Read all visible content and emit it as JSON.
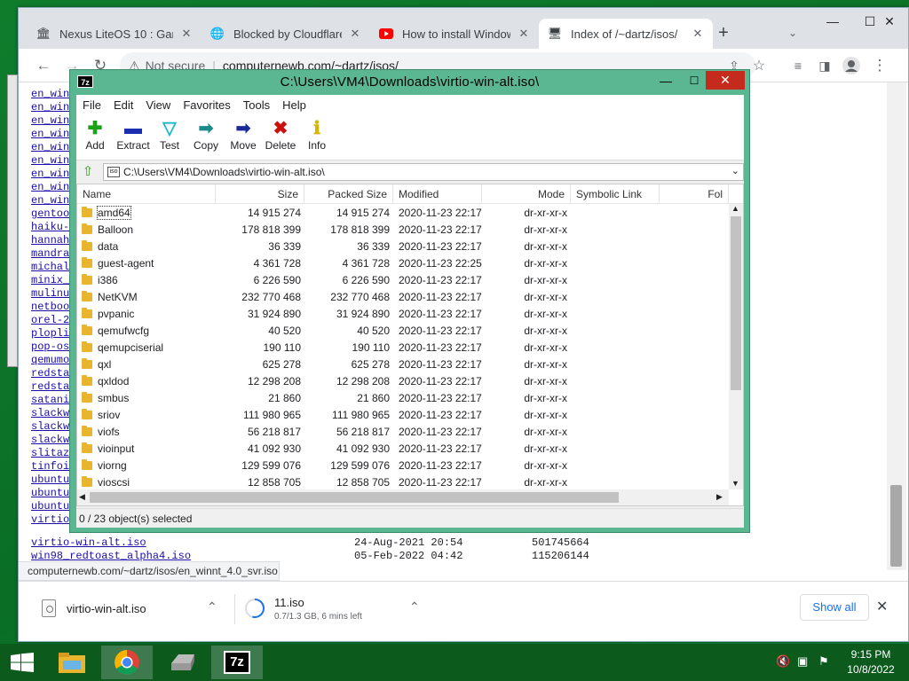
{
  "chrome": {
    "tabs": [
      {
        "title": "Nexus LiteOS 10 : Gam",
        "icon": "archive-icon"
      },
      {
        "title": "Blocked by Cloudflare C",
        "icon": "globe-icon"
      },
      {
        "title": "How to install Window",
        "icon": "youtube-icon"
      },
      {
        "title": "Index of /~dartz/isos/",
        "icon": "site-icon",
        "active": true
      }
    ],
    "new_tab": "+",
    "omnibox": {
      "security": "Not secure",
      "url": "computernewb.com/~dartz/isos/"
    },
    "status_url": "computernewb.com/~dartz/isos/en_winnt_4.0_svr.iso"
  },
  "listing": {
    "links": [
      "en_win",
      "en_win",
      "en_win",
      "en_win",
      "en_win",
      "en_win",
      "en_win",
      "en_win",
      "en_win",
      "gentoo",
      "haiku-",
      "hannah",
      "mandra",
      "michal",
      "minix_",
      "mulinu",
      "netboo",
      "orel-2",
      "plopli",
      "pop-os",
      "qemumo",
      "redsta",
      "redsta",
      "satani",
      "slackw",
      "slackw",
      "slackw",
      "slitaz",
      "tinfoi",
      "ubuntu",
      "ubuntu",
      "ubuntu",
      "virtio"
    ],
    "full_rows": [
      {
        "name": "virtio-win-alt.iso",
        "date": "24-Aug-2021 20:54",
        "size": "501745664"
      },
      {
        "name": "win98_redtoast_alpha4.iso",
        "date": "05-Feb-2022 04:42",
        "size": "115206144"
      }
    ]
  },
  "downloads": {
    "items": [
      {
        "name": "virtio-win-alt.iso",
        "detail": ""
      },
      {
        "name": "11.iso",
        "detail": "0.7/1.3 GB, 6 mins left",
        "progress": 0.54
      }
    ],
    "show_all": "Show all"
  },
  "sevenzip": {
    "title": "C:\\Users\\VM4\\Downloads\\virtio-win-alt.iso\\",
    "logo": "7z",
    "menu": [
      "File",
      "Edit",
      "View",
      "Favorites",
      "Tools",
      "Help"
    ],
    "tools": [
      {
        "label": "Add",
        "icon": "plus-icon",
        "color": "#1aa31a"
      },
      {
        "label": "Extract",
        "icon": "minus-icon",
        "color": "#1b2fb0"
      },
      {
        "label": "Test",
        "icon": "check-icon",
        "color": "#17b9c9"
      },
      {
        "label": "Copy",
        "icon": "copy-arrow-icon",
        "color": "#1a8a8a"
      },
      {
        "label": "Move",
        "icon": "move-arrow-icon",
        "color": "#1a2a9a"
      },
      {
        "label": "Delete",
        "icon": "x-icon",
        "color": "#cc1111"
      },
      {
        "label": "Info",
        "icon": "info-icon",
        "color": "#d9b400"
      }
    ],
    "address": "C:\\Users\\VM4\\Downloads\\virtio-win-alt.iso\\",
    "columns": [
      "Name",
      "Size",
      "Packed Size",
      "Modified",
      "Mode",
      "Symbolic Link",
      "Fol"
    ],
    "rows": [
      {
        "name": "amd64",
        "size": "14 915 274",
        "packed": "14 915 274",
        "modified": "2020-11-23 22:17",
        "mode": "dr-xr-xr-x"
      },
      {
        "name": "Balloon",
        "size": "178 818 399",
        "packed": "178 818 399",
        "modified": "2020-11-23 22:17",
        "mode": "dr-xr-xr-x"
      },
      {
        "name": "data",
        "size": "36 339",
        "packed": "36 339",
        "modified": "2020-11-23 22:17",
        "mode": "dr-xr-xr-x"
      },
      {
        "name": "guest-agent",
        "size": "4 361 728",
        "packed": "4 361 728",
        "modified": "2020-11-23 22:25",
        "mode": "dr-xr-xr-x"
      },
      {
        "name": "i386",
        "size": "6 226 590",
        "packed": "6 226 590",
        "modified": "2020-11-23 22:17",
        "mode": "dr-xr-xr-x"
      },
      {
        "name": "NetKVM",
        "size": "232 770 468",
        "packed": "232 770 468",
        "modified": "2020-11-23 22:17",
        "mode": "dr-xr-xr-x"
      },
      {
        "name": "pvpanic",
        "size": "31 924 890",
        "packed": "31 924 890",
        "modified": "2020-11-23 22:17",
        "mode": "dr-xr-xr-x"
      },
      {
        "name": "qemufwcfg",
        "size": "40 520",
        "packed": "40 520",
        "modified": "2020-11-23 22:17",
        "mode": "dr-xr-xr-x"
      },
      {
        "name": "qemupciserial",
        "size": "190 110",
        "packed": "190 110",
        "modified": "2020-11-23 22:17",
        "mode": "dr-xr-xr-x"
      },
      {
        "name": "qxl",
        "size": "625 278",
        "packed": "625 278",
        "modified": "2020-11-23 22:17",
        "mode": "dr-xr-xr-x"
      },
      {
        "name": "qxldod",
        "size": "12 298 208",
        "packed": "12 298 208",
        "modified": "2020-11-23 22:17",
        "mode": "dr-xr-xr-x"
      },
      {
        "name": "smbus",
        "size": "21 860",
        "packed": "21 860",
        "modified": "2020-11-23 22:17",
        "mode": "dr-xr-xr-x"
      },
      {
        "name": "sriov",
        "size": "111 980 965",
        "packed": "111 980 965",
        "modified": "2020-11-23 22:17",
        "mode": "dr-xr-xr-x"
      },
      {
        "name": "viofs",
        "size": "56 218 817",
        "packed": "56 218 817",
        "modified": "2020-11-23 22:17",
        "mode": "dr-xr-xr-x"
      },
      {
        "name": "vioinput",
        "size": "41 092 930",
        "packed": "41 092 930",
        "modified": "2020-11-23 22:17",
        "mode": "dr-xr-xr-x"
      },
      {
        "name": "viorng",
        "size": "129 599 076",
        "packed": "129 599 076",
        "modified": "2020-11-23 22:17",
        "mode": "dr-xr-xr-x"
      },
      {
        "name": "vioscsi",
        "size": "12 858 705",
        "packed": "12 858 705",
        "modified": "2020-11-23 22:17",
        "mode": "dr-xr-xr-x"
      }
    ],
    "status": "0 / 23 object(s) selected"
  },
  "taskbar": {
    "apps": [
      "file-explorer-icon",
      "chrome-icon",
      "drive-icon",
      "7zip-icon"
    ],
    "time": "9:15 PM",
    "date": "10/8/2022"
  }
}
